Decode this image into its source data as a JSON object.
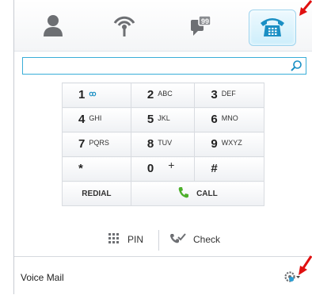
{
  "tabs": [
    {
      "icon": "contacts-person-icon"
    },
    {
      "icon": "presence-wireless-icon"
    },
    {
      "icon": "chat-bubble-icon"
    },
    {
      "icon": "phone-icon",
      "active": true
    }
  ],
  "search": {
    "value": "",
    "placeholder": ""
  },
  "keypad": {
    "rows": [
      [
        {
          "digit": "1",
          "letters": "ꝏ"
        },
        {
          "digit": "2",
          "letters": "ABC"
        },
        {
          "digit": "3",
          "letters": "DEF"
        }
      ],
      [
        {
          "digit": "4",
          "letters": "GHI"
        },
        {
          "digit": "5",
          "letters": "JKL"
        },
        {
          "digit": "6",
          "letters": "MNO"
        }
      ],
      [
        {
          "digit": "7",
          "letters": "PQRS"
        },
        {
          "digit": "8",
          "letters": "TUV"
        },
        {
          "digit": "9",
          "letters": "WXYZ"
        }
      ],
      [
        {
          "digit": "*",
          "letters": ""
        },
        {
          "digit": "0",
          "letters": "+"
        },
        {
          "digit": "#",
          "letters": ""
        }
      ]
    ],
    "redial_label": "REDIAL",
    "call_label": "CALL"
  },
  "utility": {
    "pin_label": "PIN",
    "check_label": "Check"
  },
  "status": {
    "voice_mail": "Voice Mail"
  },
  "colors": {
    "accent": "#3aaed8",
    "arrow": "#e01010",
    "call_green": "#4caf2b"
  }
}
